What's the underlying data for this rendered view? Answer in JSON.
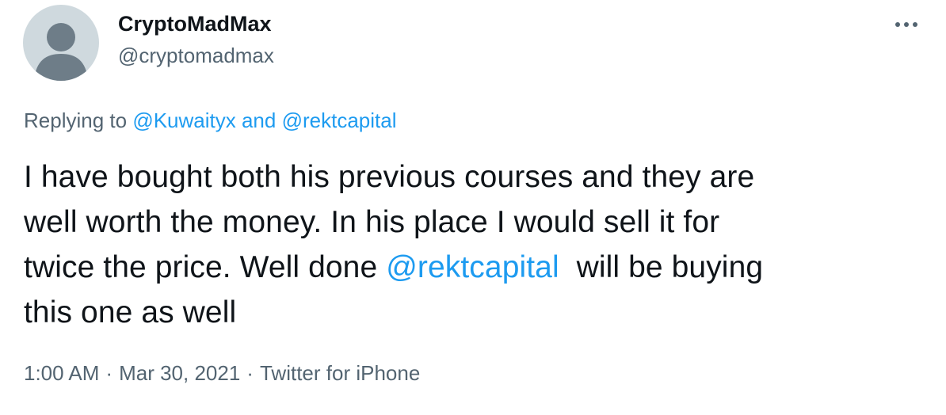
{
  "author": {
    "display_name": "CryptoMadMax",
    "handle": "@cryptomadmax"
  },
  "more_icon": "more-dots-icon",
  "reply_context": {
    "prefix": "Replying to ",
    "mention_1": "@Kuwaityx",
    "joiner": " and ",
    "mention_2": "@rektcapital"
  },
  "tweet": {
    "line_1": "I have bought both his previous courses and they are",
    "line_2": "well worth the money. In his place I would sell it for",
    "line_3_before": "twice the price. Well done ",
    "line_3_mention": "@rektcapital",
    "line_3_after": "  will be buying",
    "line_4": "this one as well"
  },
  "meta": {
    "time": "1:00 AM",
    "date": "Mar 30, 2021",
    "source": "Twitter for iPhone",
    "separator": "·"
  },
  "colors": {
    "link": "#1d9bf0",
    "text": "#0f1419",
    "secondary": "#536471",
    "avatar_bg": "#cfd9de",
    "avatar_fg": "#6e7d88"
  }
}
